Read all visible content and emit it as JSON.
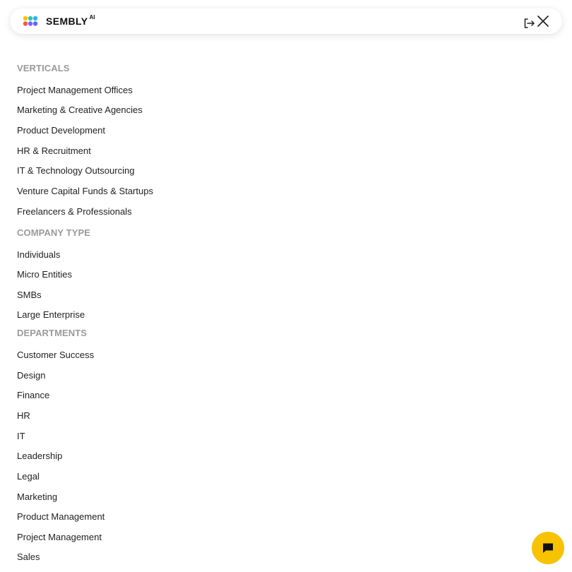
{
  "header": {
    "logo_text": "SEMBLY",
    "logo_superscript": "AI",
    "icons": {
      "login": "login-icon",
      "close": "close-icon"
    }
  },
  "sections": {
    "verticals": {
      "title": "VERTICALS",
      "items": [
        "Project Management Offices",
        "Marketing & Creative Agencies",
        "Product Development",
        "HR & Recruitment",
        "IT & Technology Outsourcing",
        "Venture Capital Funds & Startups",
        "Freelancers & Professionals"
      ]
    },
    "company_type": {
      "title": "COMPANY TYPE",
      "items": [
        "Individuals",
        "Micro Entities",
        "SMBs",
        "Large Enterprise"
      ]
    },
    "departments": {
      "title": "DEPARTMENTS",
      "items": [
        "Customer Success",
        "Design",
        "Finance",
        "HR",
        "IT",
        "Leadership",
        "Legal",
        "Marketing",
        "Product Management",
        "Project Management",
        "Sales"
      ]
    }
  },
  "chat": {
    "icon": "chat-bubble-icon",
    "color": "#f7c300"
  },
  "colors": {
    "section_title": "#9a9a9a",
    "item_text": "#1f1f1f",
    "accent": "#f7c300"
  }
}
